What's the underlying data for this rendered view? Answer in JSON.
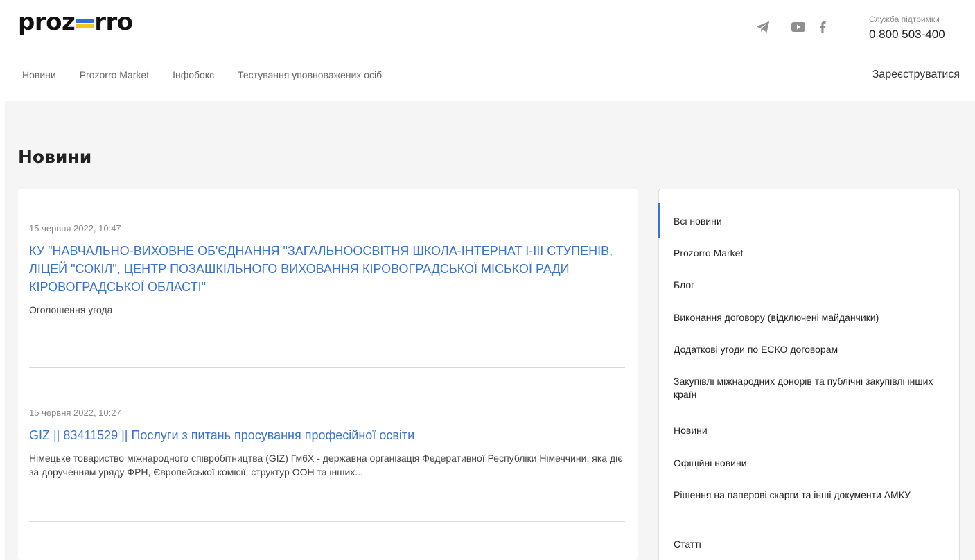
{
  "header": {
    "logo_left": "proz",
    "logo_right": "rro",
    "support_label": "Служба підтримки",
    "support_phone": "0 800 503-400",
    "register_label": "Зареєструватися"
  },
  "nav": {
    "items": [
      "Новини",
      "Prozorro Market",
      "Інфобокс",
      "Тестування уповноважених осіб"
    ]
  },
  "page": {
    "title": "Новини"
  },
  "news": [
    {
      "date": "15 червня 2022, 10:47",
      "title": "КУ \"НАВЧАЛЬНО-ВИХОВНЕ ОБ'ЄДНАННЯ \"ЗАГАЛЬНООСВІТНЯ ШКОЛА-ІНТЕРНАТ І-ІІІ СТУПЕНІВ, ЛІЦЕЙ \"СОКІЛ\", ЦЕНТР ПОЗАШКІЛЬНОГО ВИХОВАННЯ КІРОВОГРАДСЬКОЇ МІСЬКОЇ РАДИ КІРОВОГРАДСЬКОЇ ОБЛАСТІ\"",
      "description": "Оголошення угода"
    },
    {
      "date": "15 червня 2022, 10:27",
      "title": "GIZ || 83411529 || Послуги з питань просування професійної освіти",
      "description": "Німецьке товариство міжнародного співробітництва (GIZ) Гм6Х - державна організація Федеративної Республіки Німеччини, яка діє за дорученням уряду ФРН, Європейської комісії, структур ООН та інших..."
    }
  ],
  "sidebar": {
    "items": [
      "Всі новини",
      "Prozorro Market",
      "Блог",
      "Виконання договору (відключені майданчики)",
      "Додаткові угоди по ЕСКО договорам",
      "Закупівлі міжнародних донорів та публічні закупівлі інших країн",
      "Новини",
      "Офіційні новини",
      "Рішення на паперові скарги та інші документи АМКУ",
      "Статті"
    ]
  },
  "colors": {
    "accent": "#3a73c7",
    "flag_blue": "#2f6fd6",
    "flag_yellow": "#f5c518",
    "background": "#f5f5f5"
  },
  "icons": [
    "telegram-icon",
    "youtube-icon",
    "facebook-icon"
  ]
}
